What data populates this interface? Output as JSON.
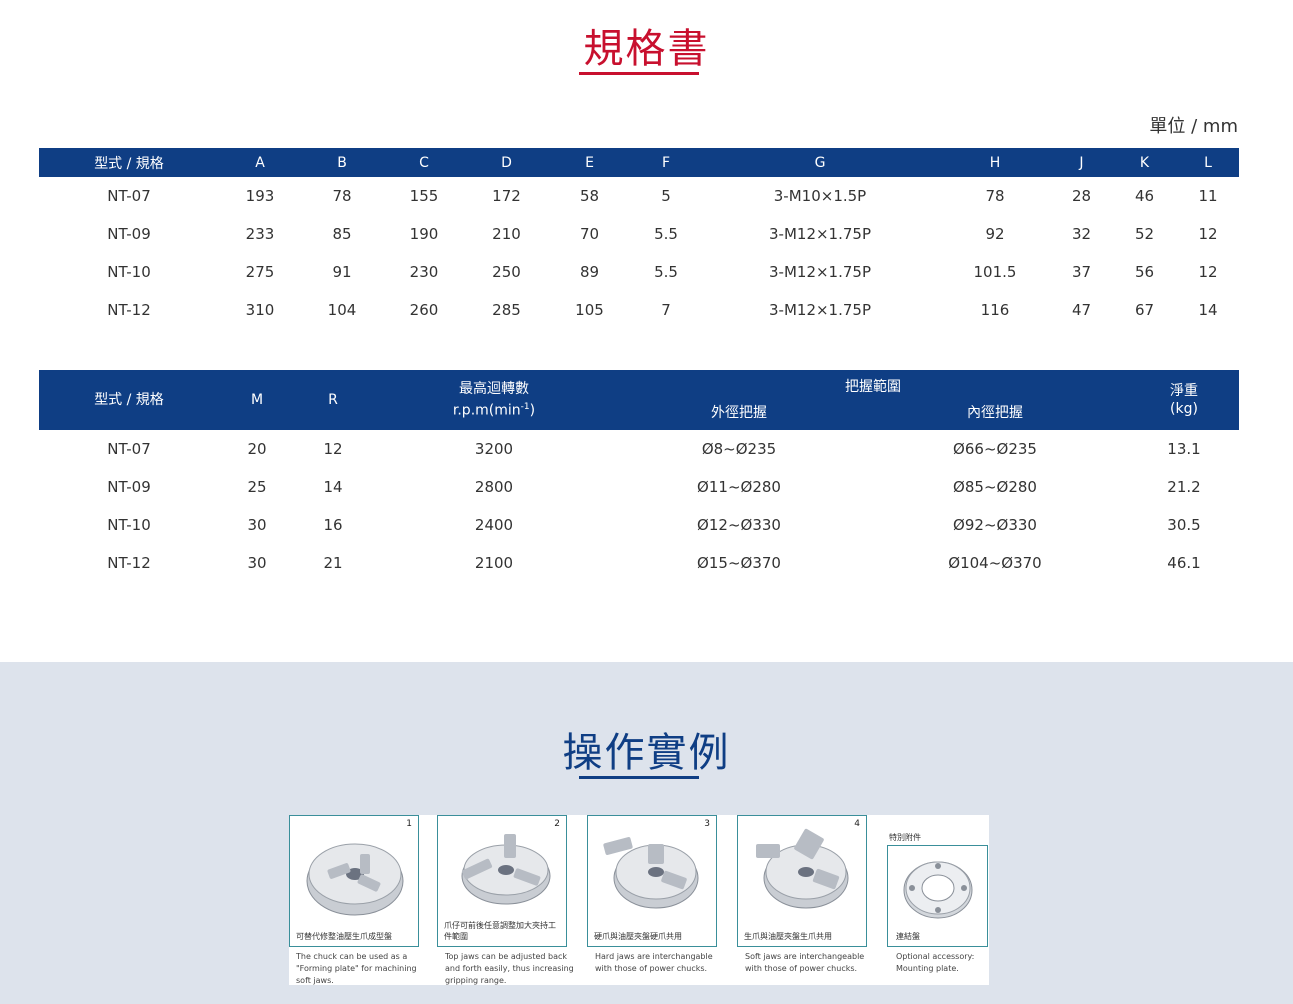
{
  "spec_section": {
    "title": "規格書",
    "unit": "單位 / mm"
  },
  "table1": {
    "headers": [
      "型式 / 規格",
      "A",
      "B",
      "C",
      "D",
      "E",
      "F",
      "G",
      "H",
      "J",
      "K",
      "L"
    ],
    "rows": [
      [
        "NT-07",
        "193",
        "78",
        "155",
        "172",
        "58",
        "5",
        "3-M10×1.5P",
        "78",
        "28",
        "46",
        "11"
      ],
      [
        "NT-09",
        "233",
        "85",
        "190",
        "210",
        "70",
        "5.5",
        "3-M12×1.75P",
        "92",
        "32",
        "52",
        "12"
      ],
      [
        "NT-10",
        "275",
        "91",
        "230",
        "250",
        "89",
        "5.5",
        "3-M12×1.75P",
        "101.5",
        "37",
        "56",
        "12"
      ],
      [
        "NT-12",
        "310",
        "104",
        "260",
        "285",
        "105",
        "7",
        "3-M12×1.75P",
        "116",
        "47",
        "67",
        "14"
      ]
    ]
  },
  "table2": {
    "headers": {
      "model": "型式 / 規格",
      "m": "M",
      "r": "R",
      "max_speed_line1": "最高迴轉數",
      "max_speed_line2": "r.p.m(min",
      "max_speed_sup": "-1",
      "max_speed_close": ")",
      "grip_range": "把握範圍",
      "outer_grip": "外徑把握",
      "inner_grip": "內徑把握",
      "weight_line1": "淨重",
      "weight_line2": "(kg)"
    },
    "rows": [
      [
        "NT-07",
        "20",
        "12",
        "3200",
        "Ø8~Ø235",
        "Ø66~Ø235",
        "13.1"
      ],
      [
        "NT-09",
        "25",
        "14",
        "2800",
        "Ø11~Ø280",
        "Ø85~Ø280",
        "21.2"
      ],
      [
        "NT-10",
        "30",
        "16",
        "2400",
        "Ø12~Ø330",
        "Ø92~Ø330",
        "30.5"
      ],
      [
        "NT-12",
        "30",
        "21",
        "2100",
        "Ø15~Ø370",
        "Ø104~Ø370",
        "46.1"
      ]
    ]
  },
  "operation_section": {
    "title": "操作實例",
    "cards": [
      {
        "num": "1",
        "caption": "可替代修整油壓生爪成型盤",
        "en": "The chuck can be used as a \"Forming plate\" for machining soft jaws."
      },
      {
        "num": "2",
        "caption": "爪仔可前後任意調整加大夾持工件範圍",
        "en": "Top jaws can be adjusted back and forth easily, thus increasing gripping range."
      },
      {
        "num": "3",
        "caption": "硬爪與油壓夾盤硬爪共用",
        "en": "Hard jaws are interchangable with those of power chucks."
      },
      {
        "num": "4",
        "caption": "生爪與油壓夾盤生爪共用",
        "en": "Soft jaws are interchangeable with those of power chucks."
      }
    ],
    "accessory": {
      "label": "特別附件",
      "caption": "連結盤",
      "en": "Optional accessory: Mounting plate."
    }
  },
  "colors": {
    "header_bg": "#0f3e84",
    "spec_title": "#c8102e",
    "op_title": "#0f3e84",
    "bottom_bg": "#dde3ec"
  }
}
